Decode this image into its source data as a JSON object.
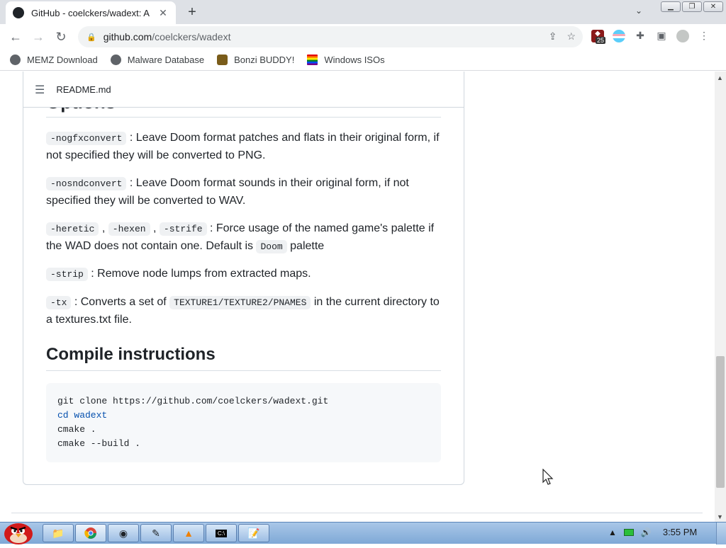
{
  "browser": {
    "tab_title": "GitHub - coelckers/wadext: A",
    "tab_close": "✕",
    "new_tab": "+",
    "url_host": "github.com",
    "url_path": "/coelckers/wadext",
    "extension_badge": "25"
  },
  "bookmarks": [
    {
      "label": "MEMZ Download",
      "icon": "globe-icon"
    },
    {
      "label": "Malware Database",
      "icon": "globe-icon"
    },
    {
      "label": "Bonzi BUDDY!",
      "icon": "bonzi-icon"
    },
    {
      "label": "Windows ISOs",
      "icon": "windows-flag-icon"
    }
  ],
  "readme": {
    "filename": "README.md",
    "options_heading": "Options",
    "options": [
      {
        "code": [
          "-nogfxconvert"
        ],
        "text": ": Leave Doom format patches and flats in their original form, if not specified they will be converted to PNG."
      },
      {
        "code": [
          "-nosndconvert"
        ],
        "text": ": Leave Doom format sounds in their original form, if not specified they will be converted to WAV."
      },
      {
        "code": [
          "-heretic",
          "-hexen",
          "-strife"
        ],
        "text": ": Force usage of the named game's palette if the WAD does not contain one. Default is",
        "trail_code": "Doom",
        "trail_text": "palette"
      },
      {
        "code": [
          "-strip"
        ],
        "text": ": Remove node lumps from extracted maps."
      },
      {
        "code": [
          "-tx"
        ],
        "text": ": Converts a set of",
        "mid_code": "TEXTURE1/TEXTURE2/PNAMES",
        "trail_text": "in the current directory to a textures.txt file."
      }
    ],
    "compile_heading": "Compile instructions",
    "compile_lines": [
      "git clone https://github.com/coelckers/wadext.git",
      "cd wadext",
      "cmake .",
      "cmake --build ."
    ]
  },
  "taskbar": {
    "clock": "3:55 PM"
  }
}
